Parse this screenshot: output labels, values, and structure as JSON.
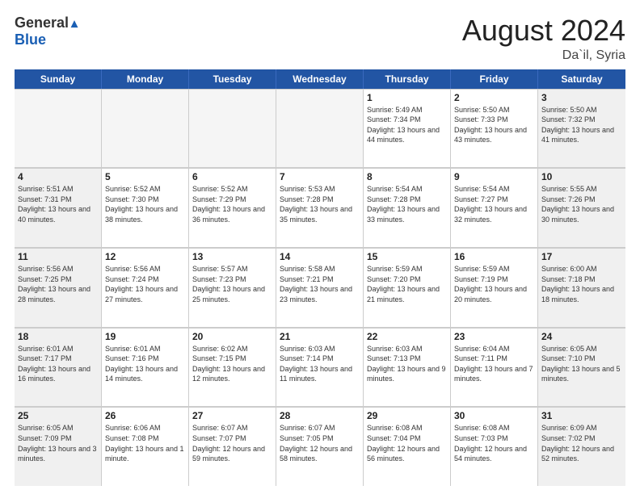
{
  "header": {
    "logo_general": "General",
    "logo_blue": "Blue",
    "month_title": "August 2024",
    "location": "Da`il, Syria"
  },
  "calendar": {
    "days_of_week": [
      "Sunday",
      "Monday",
      "Tuesday",
      "Wednesday",
      "Thursday",
      "Friday",
      "Saturday"
    ],
    "weeks": [
      [
        {
          "day": "",
          "empty": true
        },
        {
          "day": "",
          "empty": true
        },
        {
          "day": "",
          "empty": true
        },
        {
          "day": "",
          "empty": true
        },
        {
          "day": "1",
          "sunrise": "5:49 AM",
          "sunset": "7:34 PM",
          "daylight": "13 hours and 44 minutes."
        },
        {
          "day": "2",
          "sunrise": "5:50 AM",
          "sunset": "7:33 PM",
          "daylight": "13 hours and 43 minutes."
        },
        {
          "day": "3",
          "sunrise": "5:50 AM",
          "sunset": "7:32 PM",
          "daylight": "13 hours and 41 minutes."
        }
      ],
      [
        {
          "day": "4",
          "sunrise": "5:51 AM",
          "sunset": "7:31 PM",
          "daylight": "13 hours and 40 minutes."
        },
        {
          "day": "5",
          "sunrise": "5:52 AM",
          "sunset": "7:30 PM",
          "daylight": "13 hours and 38 minutes."
        },
        {
          "day": "6",
          "sunrise": "5:52 AM",
          "sunset": "7:29 PM",
          "daylight": "13 hours and 36 minutes."
        },
        {
          "day": "7",
          "sunrise": "5:53 AM",
          "sunset": "7:28 PM",
          "daylight": "13 hours and 35 minutes."
        },
        {
          "day": "8",
          "sunrise": "5:54 AM",
          "sunset": "7:28 PM",
          "daylight": "13 hours and 33 minutes."
        },
        {
          "day": "9",
          "sunrise": "5:54 AM",
          "sunset": "7:27 PM",
          "daylight": "13 hours and 32 minutes."
        },
        {
          "day": "10",
          "sunrise": "5:55 AM",
          "sunset": "7:26 PM",
          "daylight": "13 hours and 30 minutes."
        }
      ],
      [
        {
          "day": "11",
          "sunrise": "5:56 AM",
          "sunset": "7:25 PM",
          "daylight": "13 hours and 28 minutes."
        },
        {
          "day": "12",
          "sunrise": "5:56 AM",
          "sunset": "7:24 PM",
          "daylight": "13 hours and 27 minutes."
        },
        {
          "day": "13",
          "sunrise": "5:57 AM",
          "sunset": "7:23 PM",
          "daylight": "13 hours and 25 minutes."
        },
        {
          "day": "14",
          "sunrise": "5:58 AM",
          "sunset": "7:21 PM",
          "daylight": "13 hours and 23 minutes."
        },
        {
          "day": "15",
          "sunrise": "5:59 AM",
          "sunset": "7:20 PM",
          "daylight": "13 hours and 21 minutes."
        },
        {
          "day": "16",
          "sunrise": "5:59 AM",
          "sunset": "7:19 PM",
          "daylight": "13 hours and 20 minutes."
        },
        {
          "day": "17",
          "sunrise": "6:00 AM",
          "sunset": "7:18 PM",
          "daylight": "13 hours and 18 minutes."
        }
      ],
      [
        {
          "day": "18",
          "sunrise": "6:01 AM",
          "sunset": "7:17 PM",
          "daylight": "13 hours and 16 minutes."
        },
        {
          "day": "19",
          "sunrise": "6:01 AM",
          "sunset": "7:16 PM",
          "daylight": "13 hours and 14 minutes."
        },
        {
          "day": "20",
          "sunrise": "6:02 AM",
          "sunset": "7:15 PM",
          "daylight": "13 hours and 12 minutes."
        },
        {
          "day": "21",
          "sunrise": "6:03 AM",
          "sunset": "7:14 PM",
          "daylight": "13 hours and 11 minutes."
        },
        {
          "day": "22",
          "sunrise": "6:03 AM",
          "sunset": "7:13 PM",
          "daylight": "13 hours and 9 minutes."
        },
        {
          "day": "23",
          "sunrise": "6:04 AM",
          "sunset": "7:11 PM",
          "daylight": "13 hours and 7 minutes."
        },
        {
          "day": "24",
          "sunrise": "6:05 AM",
          "sunset": "7:10 PM",
          "daylight": "13 hours and 5 minutes."
        }
      ],
      [
        {
          "day": "25",
          "sunrise": "6:05 AM",
          "sunset": "7:09 PM",
          "daylight": "13 hours and 3 minutes."
        },
        {
          "day": "26",
          "sunrise": "6:06 AM",
          "sunset": "7:08 PM",
          "daylight": "13 hours and 1 minute."
        },
        {
          "day": "27",
          "sunrise": "6:07 AM",
          "sunset": "7:07 PM",
          "daylight": "12 hours and 59 minutes."
        },
        {
          "day": "28",
          "sunrise": "6:07 AM",
          "sunset": "7:05 PM",
          "daylight": "12 hours and 58 minutes."
        },
        {
          "day": "29",
          "sunrise": "6:08 AM",
          "sunset": "7:04 PM",
          "daylight": "12 hours and 56 minutes."
        },
        {
          "day": "30",
          "sunrise": "6:08 AM",
          "sunset": "7:03 PM",
          "daylight": "12 hours and 54 minutes."
        },
        {
          "day": "31",
          "sunrise": "6:09 AM",
          "sunset": "7:02 PM",
          "daylight": "12 hours and 52 minutes."
        }
      ]
    ]
  }
}
